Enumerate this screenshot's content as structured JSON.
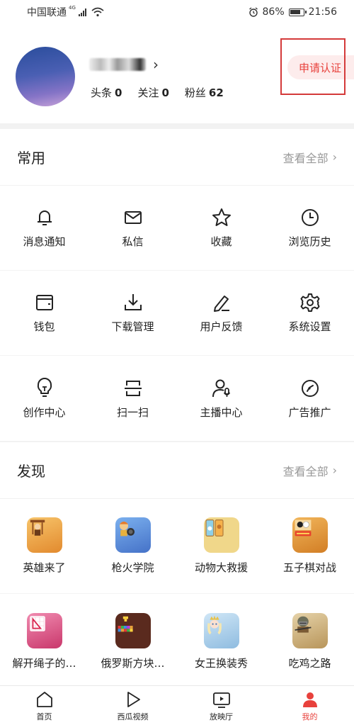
{
  "status_bar": {
    "carrier": "中国联通",
    "network": "4G",
    "battery": "86%",
    "time": "21:56"
  },
  "profile": {
    "stats": [
      {
        "label": "头条",
        "value": "0"
      },
      {
        "label": "关注",
        "value": "0"
      },
      {
        "label": "粉丝",
        "value": "62"
      }
    ],
    "apply_label": "申请认证"
  },
  "common": {
    "title": "常用",
    "more": "查看全部",
    "items": [
      {
        "label": "消息通知",
        "icon": "bell-icon"
      },
      {
        "label": "私信",
        "icon": "envelope-icon"
      },
      {
        "label": "收藏",
        "icon": "star-icon"
      },
      {
        "label": "浏览历史",
        "icon": "clock-icon"
      },
      {
        "label": "钱包",
        "icon": "wallet-icon"
      },
      {
        "label": "下载管理",
        "icon": "download-icon"
      },
      {
        "label": "用户反馈",
        "icon": "pen-icon"
      },
      {
        "label": "系统设置",
        "icon": "gear-icon"
      },
      {
        "label": "创作中心",
        "icon": "bulb-icon"
      },
      {
        "label": "扫一扫",
        "icon": "scan-icon"
      },
      {
        "label": "主播中心",
        "icon": "anchor-user-icon"
      },
      {
        "label": "广告推广",
        "icon": "compass-icon"
      }
    ]
  },
  "discover": {
    "title": "发现",
    "more": "查看全部",
    "games": [
      {
        "label": "英雄来了",
        "icon": "hero-game-icon",
        "color": "#e9a33b"
      },
      {
        "label": "枪火学院",
        "icon": "gunfire-game-icon",
        "color": "#5b8fd9"
      },
      {
        "label": "动物大救援",
        "icon": "animal-rescue-game-icon",
        "color": "#e8c45a"
      },
      {
        "label": "五子棋对战",
        "icon": "gomoku-game-icon",
        "color": "#d98a2b"
      },
      {
        "label": "解开绳子的…",
        "icon": "rope-game-icon",
        "color": "#d94b7a"
      },
      {
        "label": "俄罗斯方块…",
        "icon": "tetris-game-icon",
        "color": "#7a3b2a"
      },
      {
        "label": "女王换装秀",
        "icon": "queen-dressup-game-icon",
        "color": "#9fc6e6"
      },
      {
        "label": "吃鸡之路",
        "icon": "chicken-game-icon",
        "color": "#c9a86b"
      }
    ]
  },
  "bottom_nav": [
    {
      "label": "首页",
      "icon": "home-icon"
    },
    {
      "label": "西瓜视频",
      "icon": "play-icon"
    },
    {
      "label": "放映厅",
      "icon": "tv-icon"
    },
    {
      "label": "我的",
      "icon": "profile-icon"
    }
  ]
}
